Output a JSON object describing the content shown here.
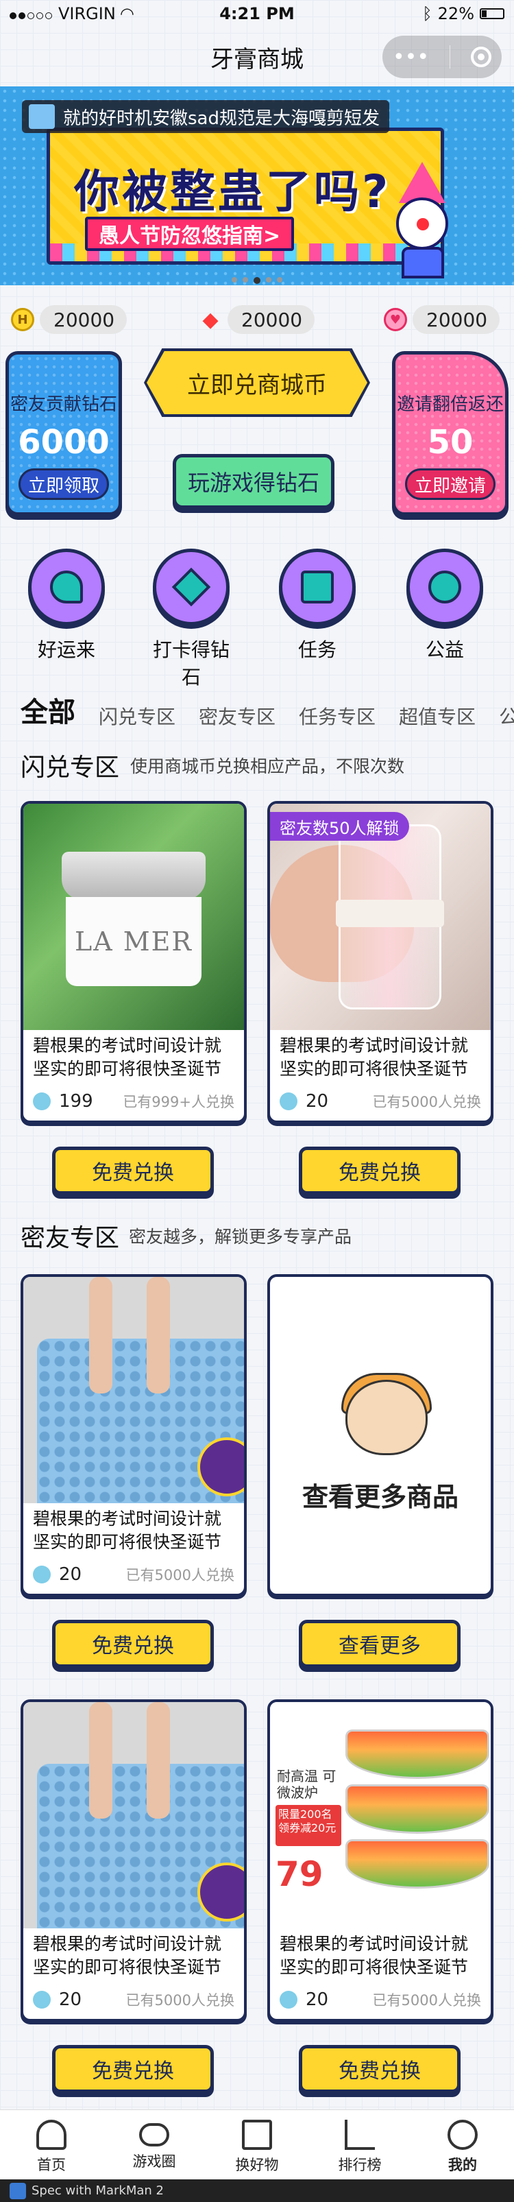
{
  "status_bar": {
    "carrier": "VIRGIN",
    "time": "4:21 PM",
    "battery": "22%"
  },
  "nav": {
    "title": "牙膏商城",
    "capsule_more": "•••"
  },
  "banner": {
    "notice": "就的好时机安徽sad规范是大海嘎剪短发",
    "headline": "你被整蛊了吗?",
    "sub": "愚人节防忽悠指南>"
  },
  "balances": [
    {
      "icon": "H",
      "value": "20000",
      "icon_name": "coin-icon"
    },
    {
      "icon": "◆",
      "value": "20000",
      "icon_name": "diamond-icon"
    },
    {
      "icon": "♥",
      "value": "20000",
      "icon_name": "heart-icon"
    }
  ],
  "actions": {
    "contrib": {
      "title": "密友贡献钻石",
      "value": "6000",
      "button": "立即领取"
    },
    "exchange": "立即兑商城币",
    "game": "玩游戏得钻石",
    "invite": {
      "title": "邀请翻倍返还",
      "value": "50",
      "button": "立即邀请"
    }
  },
  "features": [
    {
      "label": "好运来",
      "icon": "clover-icon"
    },
    {
      "label": "打卡得钻石",
      "icon": "diamond-icon"
    },
    {
      "label": "任务",
      "icon": "clipboard-icon"
    },
    {
      "label": "公益",
      "icon": "charity-icon"
    }
  ],
  "tabs": [
    "全部",
    "闪兑专区",
    "密友专区",
    "任务专区",
    "超值专区",
    "公益"
  ],
  "section1": {
    "title": "闪兑专区",
    "desc": "使用商城币兑换相应产品，不限次数",
    "cards": [
      {
        "desc": "碧根果的考试时间设计就坚实的即可将很快圣诞节",
        "price": "199",
        "count": "已有999+人兑换",
        "brand": "LA MER",
        "button": "免费兑换"
      },
      {
        "desc": "碧根果的考试时间设计就坚实的即可将很快圣诞节",
        "price": "20",
        "count": "已有5000人兑换",
        "tag": "密友数50人解锁",
        "button": "免费兑换"
      }
    ]
  },
  "section2": {
    "title": "密友专区",
    "desc": "密友越多，解锁更多专享产品",
    "cards": [
      {
        "desc": "碧根果的考试时间设计就坚实的即可将很快圣诞节",
        "price": "20",
        "count": "已有5000人兑换",
        "button": "免费兑换"
      },
      {
        "more_title": "查看更多商品",
        "button": "查看更多"
      }
    ]
  },
  "section3": {
    "cards": [
      {
        "desc": "碧根果的考试时间设计就坚实的即可将很快圣诞节",
        "price": "20",
        "count": "已有5000人兑换",
        "button": "免费兑换"
      },
      {
        "desc": "碧根果的考试时间设计就坚实的即可将很快圣诞节",
        "price": "20",
        "count": "已有5000人兑换",
        "promo1": "耐高温 可微波炉",
        "promo2": "限量200名 领券减20元",
        "sale_price": "79",
        "button": "免费兑换"
      }
    ]
  },
  "tabbar": [
    "首页",
    "游戏圈",
    "换好物",
    "排行榜",
    "我的"
  ],
  "watermark": "Spec with MarkMan 2"
}
